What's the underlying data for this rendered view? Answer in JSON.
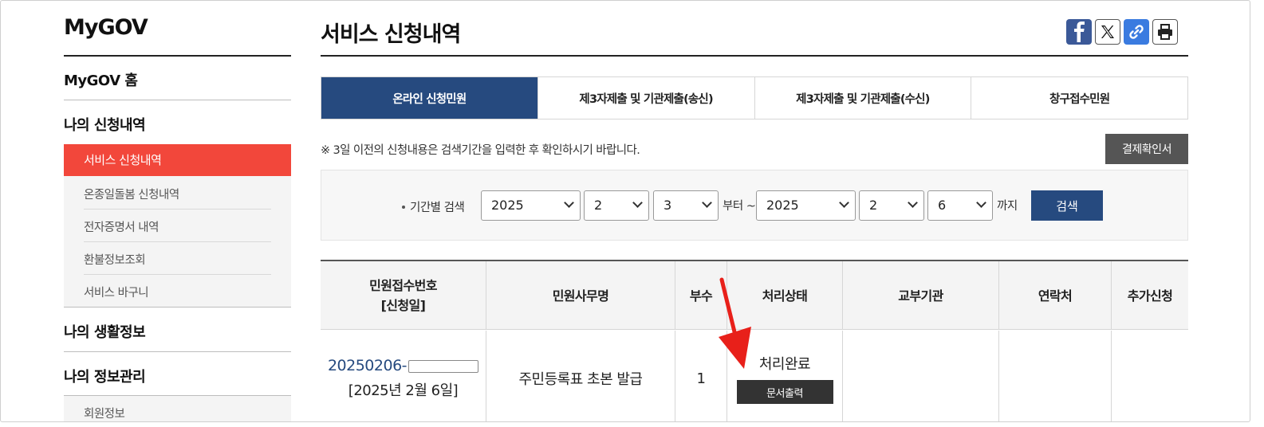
{
  "sidebar": {
    "logo": "MyGOV",
    "home": "MyGOV 홈",
    "section_my_applications": "나의 신청내역",
    "active_item": "서비스 신청내역",
    "sub_items": [
      "온종일돌봄 신청내역",
      "전자증명서 내역",
      "환불정보조회",
      "서비스 바구니"
    ],
    "section_life_info": "나의 생활정보",
    "section_info_mgmt": "나의 정보관리",
    "member_info": "회원정보"
  },
  "main": {
    "title": "서비스 신청내역",
    "share_icons": [
      "facebook-icon",
      "x-icon",
      "link-icon",
      "print-icon"
    ],
    "tabs": [
      {
        "label": "온라인 신청민원",
        "active": true
      },
      {
        "label": "제3자제출 및 기관제출(송신)",
        "active": false
      },
      {
        "label": "제3자제출 및 기관제출(수신)",
        "active": false
      },
      {
        "label": "창구접수민원",
        "active": false
      }
    ],
    "notice": "※ 3일 이전의 신청내용은 검색기간을 입력한 후 확인하시기 바랍니다.",
    "receipt_button": "결제확인서"
  },
  "search": {
    "label": "기간별 검색",
    "from_year": "2025",
    "from_month": "2",
    "from_day": "3",
    "from_suffix": "부터 ~",
    "to_year": "2025",
    "to_month": "2",
    "to_day": "6",
    "to_suffix": "까지",
    "button": "검색"
  },
  "table": {
    "headers": [
      "민원접수번호\n[신청일]",
      "민원사무명",
      "부수",
      "처리상태",
      "교부기관",
      "연락처",
      "추가신청"
    ],
    "header_line1": "민원접수번호",
    "header_line2": "[신청일]",
    "rows": [
      {
        "receipt_number": "20250206-",
        "date": "[2025년 2월 6일]",
        "service_name": "주민등록표 초본 발급",
        "copies": "1",
        "status": "처리완료",
        "print_button": "문서출력",
        "issuing_agency": "",
        "contact": "",
        "additional": ""
      }
    ]
  },
  "colors": {
    "active_tab": "#264a7f",
    "sidebar_active": "#f2473b",
    "arrow": "#e8201a"
  }
}
